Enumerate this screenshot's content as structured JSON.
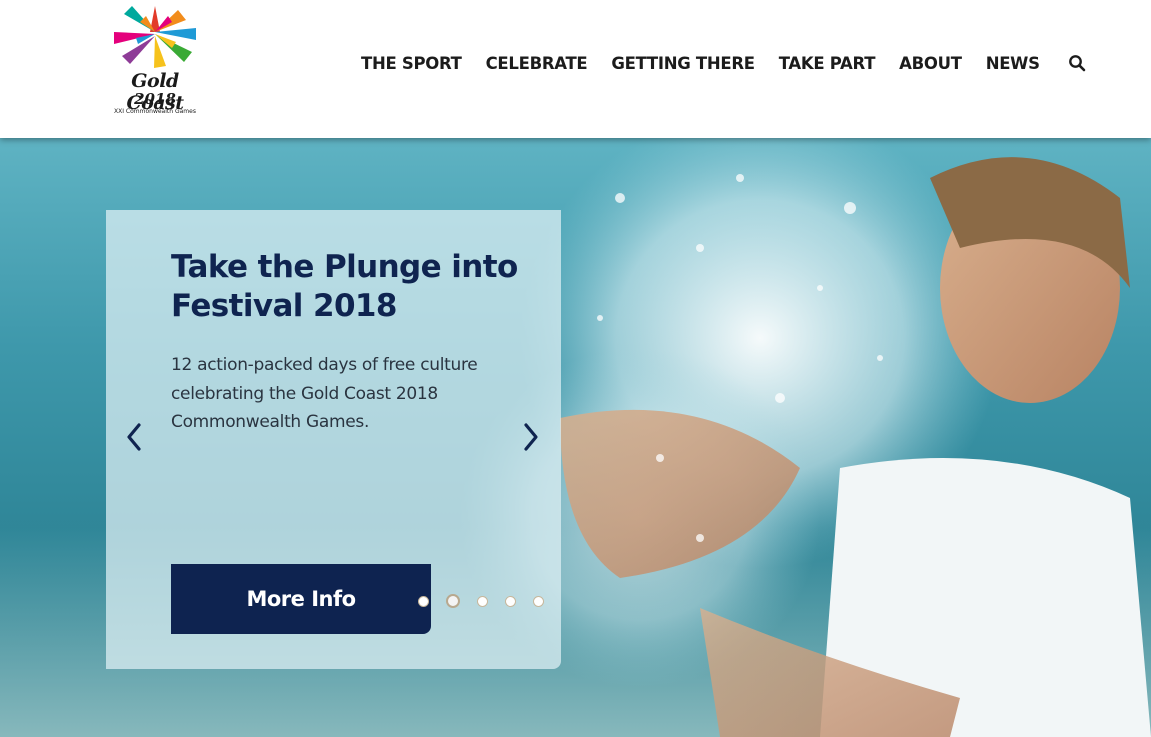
{
  "logo": {
    "line1": "Gold Coast",
    "line2": "2018",
    "line3": "XXI Commonwealth Games"
  },
  "nav": {
    "items": [
      "THE SPORT",
      "CELEBRATE",
      "GETTING THERE",
      "TAKE PART",
      "ABOUT",
      "NEWS"
    ],
    "search_icon": "search-icon"
  },
  "slide": {
    "title": "Take the Plunge into Festival 2018",
    "description": "12 action-packed days of free culture celebrating the Gold Coast 2018 Commonwealth Games.",
    "button_label": "More Info",
    "prev_icon": "chevron-left-icon",
    "next_icon": "chevron-right-icon",
    "active_index": 1,
    "total": 5
  },
  "colors": {
    "navy": "#0e2350",
    "nav_text": "#1c1c1c",
    "panel_bg": "rgba(225,241,245,0.72)"
  }
}
